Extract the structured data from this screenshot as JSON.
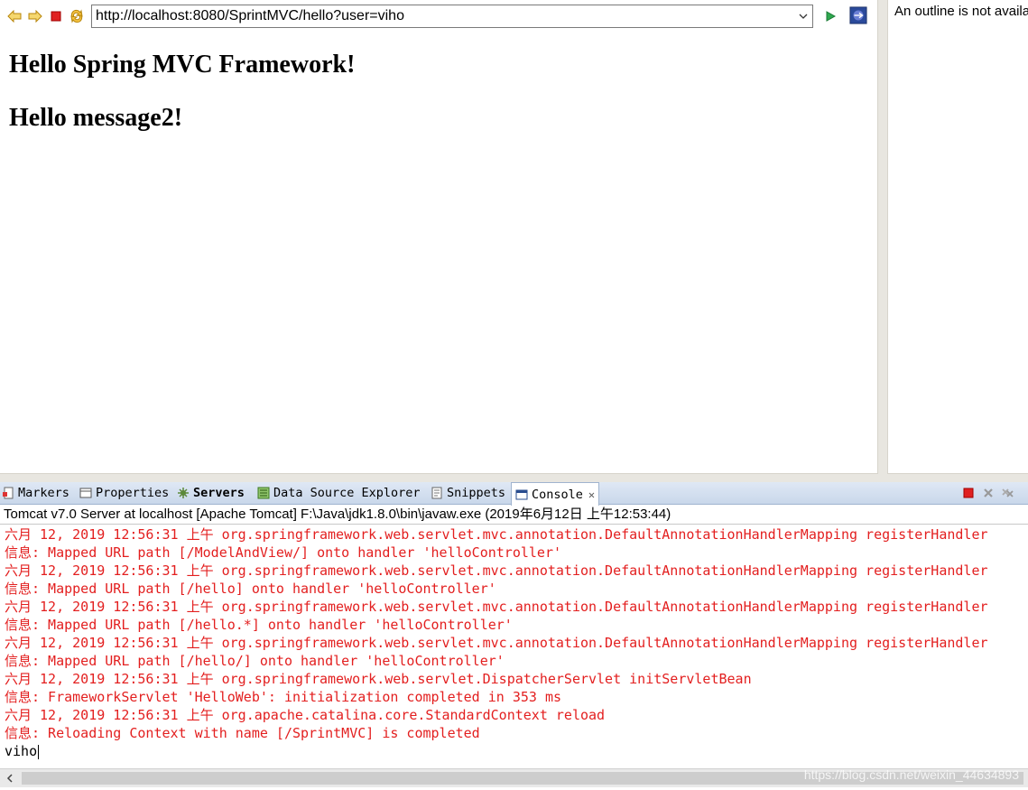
{
  "browser": {
    "url": "http://localhost:8080/SprintMVC/hello?user=viho",
    "headings": [
      "Hello Spring MVC Framework!",
      "Hello message2!"
    ]
  },
  "outline": {
    "message": "An outline is not available."
  },
  "panel": {
    "tabs": [
      {
        "label": "Markers",
        "icon": "markers-icon"
      },
      {
        "label": "Properties",
        "icon": "properties-icon"
      },
      {
        "label": "Servers",
        "icon": "servers-icon"
      },
      {
        "label": "Data Source Explorer",
        "icon": "data-source-icon"
      },
      {
        "label": "Snippets",
        "icon": "snippets-icon"
      },
      {
        "label": "Console",
        "icon": "console-icon"
      }
    ],
    "console_title": "Tomcat v7.0 Server at localhost [Apache Tomcat] F:\\Java\\jdk1.8.0\\bin\\javaw.exe (2019年6月12日 上午12:53:44)",
    "lines": [
      "六月 12, 2019 12:56:31 上午 org.springframework.web.servlet.mvc.annotation.DefaultAnnotationHandlerMapping registerHandler",
      "信息: Mapped URL path [/ModelAndView/] onto handler 'helloController'",
      "六月 12, 2019 12:56:31 上午 org.springframework.web.servlet.mvc.annotation.DefaultAnnotationHandlerMapping registerHandler",
      "信息: Mapped URL path [/hello] onto handler 'helloController'",
      "六月 12, 2019 12:56:31 上午 org.springframework.web.servlet.mvc.annotation.DefaultAnnotationHandlerMapping registerHandler",
      "信息: Mapped URL path [/hello.*] onto handler 'helloController'",
      "六月 12, 2019 12:56:31 上午 org.springframework.web.servlet.mvc.annotation.DefaultAnnotationHandlerMapping registerHandler",
      "信息: Mapped URL path [/hello/] onto handler 'helloController'",
      "六月 12, 2019 12:56:31 上午 org.springframework.web.servlet.DispatcherServlet initServletBean",
      "信息: FrameworkServlet 'HelloWeb': initialization completed in 353 ms",
      "六月 12, 2019 12:56:31 上午 org.apache.catalina.core.StandardContext reload",
      "信息: Reloading Context with name [/SprintMVC] is completed"
    ],
    "input_line": "viho",
    "watermark": "https://blog.csdn.net/weixin_44634893"
  },
  "colors": {
    "console_error": "#e31f1f",
    "tab_gradient_top": "#dfe8f5"
  }
}
